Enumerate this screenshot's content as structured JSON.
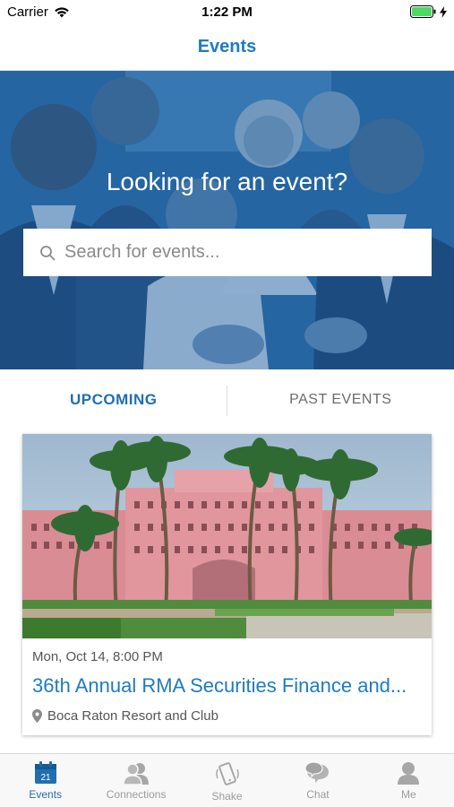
{
  "status_bar": {
    "carrier": "Carrier",
    "time": "1:22 PM"
  },
  "nav": {
    "title": "Events"
  },
  "hero": {
    "title": "Looking for an event?",
    "search_placeholder": "Search for events..."
  },
  "tabs": {
    "upcoming": "UPCOMING",
    "past": "PAST EVENTS"
  },
  "event": {
    "date": "Mon, Oct 14, 8:00 PM",
    "title": "36th Annual RMA Securities Finance and...",
    "location": "Boca Raton Resort and Club"
  },
  "tab_bar": {
    "items": [
      {
        "label": "Events",
        "icon": "calendar-icon",
        "badge": "21"
      },
      {
        "label": "Connections",
        "icon": "people-icon"
      },
      {
        "label": "Shake",
        "icon": "phone-shake-icon"
      },
      {
        "label": "Chat",
        "icon": "chat-bubbles-icon"
      },
      {
        "label": "Me",
        "icon": "person-icon"
      }
    ]
  },
  "colors": {
    "accent": "#1f7bc1",
    "hero_tint": "#2f6fa7",
    "battery": "#4cd964"
  }
}
